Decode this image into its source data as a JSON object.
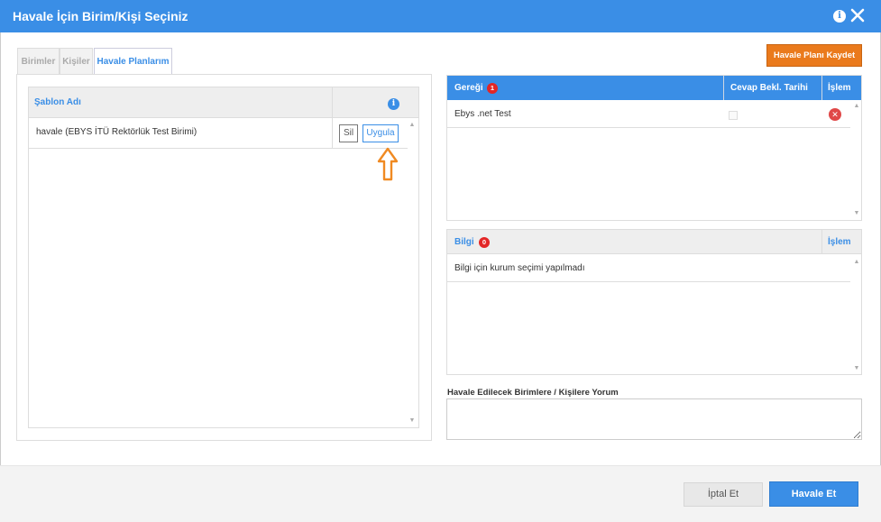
{
  "dialog": {
    "title": "Havale İçin Birim/Kişi Seçiniz",
    "info_glyph": "i"
  },
  "tabs": [
    {
      "label": "Birimler",
      "active": false
    },
    {
      "label": "Kişiler",
      "active": false
    },
    {
      "label": "Havale Planlarım",
      "active": true
    }
  ],
  "template_table": {
    "header": {
      "name": "Şablon Adı",
      "info_glyph": "i"
    },
    "rows": [
      {
        "name": "havale (EBYS İTÜ Rektörlük Test Birimi)",
        "delete_label": "Sil",
        "apply_label": "Uygula"
      }
    ]
  },
  "save_plan_button": "Havale Planı Kaydet",
  "gereği_table": {
    "header": {
      "name": "Gereği",
      "count": "1",
      "deadline": "Cevap Bekl. Tarihi",
      "action": "İşlem"
    },
    "rows": [
      {
        "name": "Ebys .net Test",
        "remove_glyph": "✕"
      }
    ]
  },
  "bilgi_table": {
    "header": {
      "name": "Bilgi",
      "count": "0",
      "action": "İşlem"
    },
    "rows": [
      {
        "name": "Bilgi için kurum seçimi yapılmadı"
      }
    ]
  },
  "comment": {
    "label": "Havale Edilecek Birimlere / Kişilere Yorum",
    "value": ""
  },
  "footer": {
    "cancel_label": "İptal Et",
    "submit_label": "Havale Et"
  },
  "colors": {
    "primary": "#3a8ee6",
    "orange": "#ea7a1c",
    "badge_red": "#e32626"
  },
  "icons": {
    "close": "close-icon",
    "info": "info-icon",
    "annotation_arrow": "arrow-up-icon"
  }
}
